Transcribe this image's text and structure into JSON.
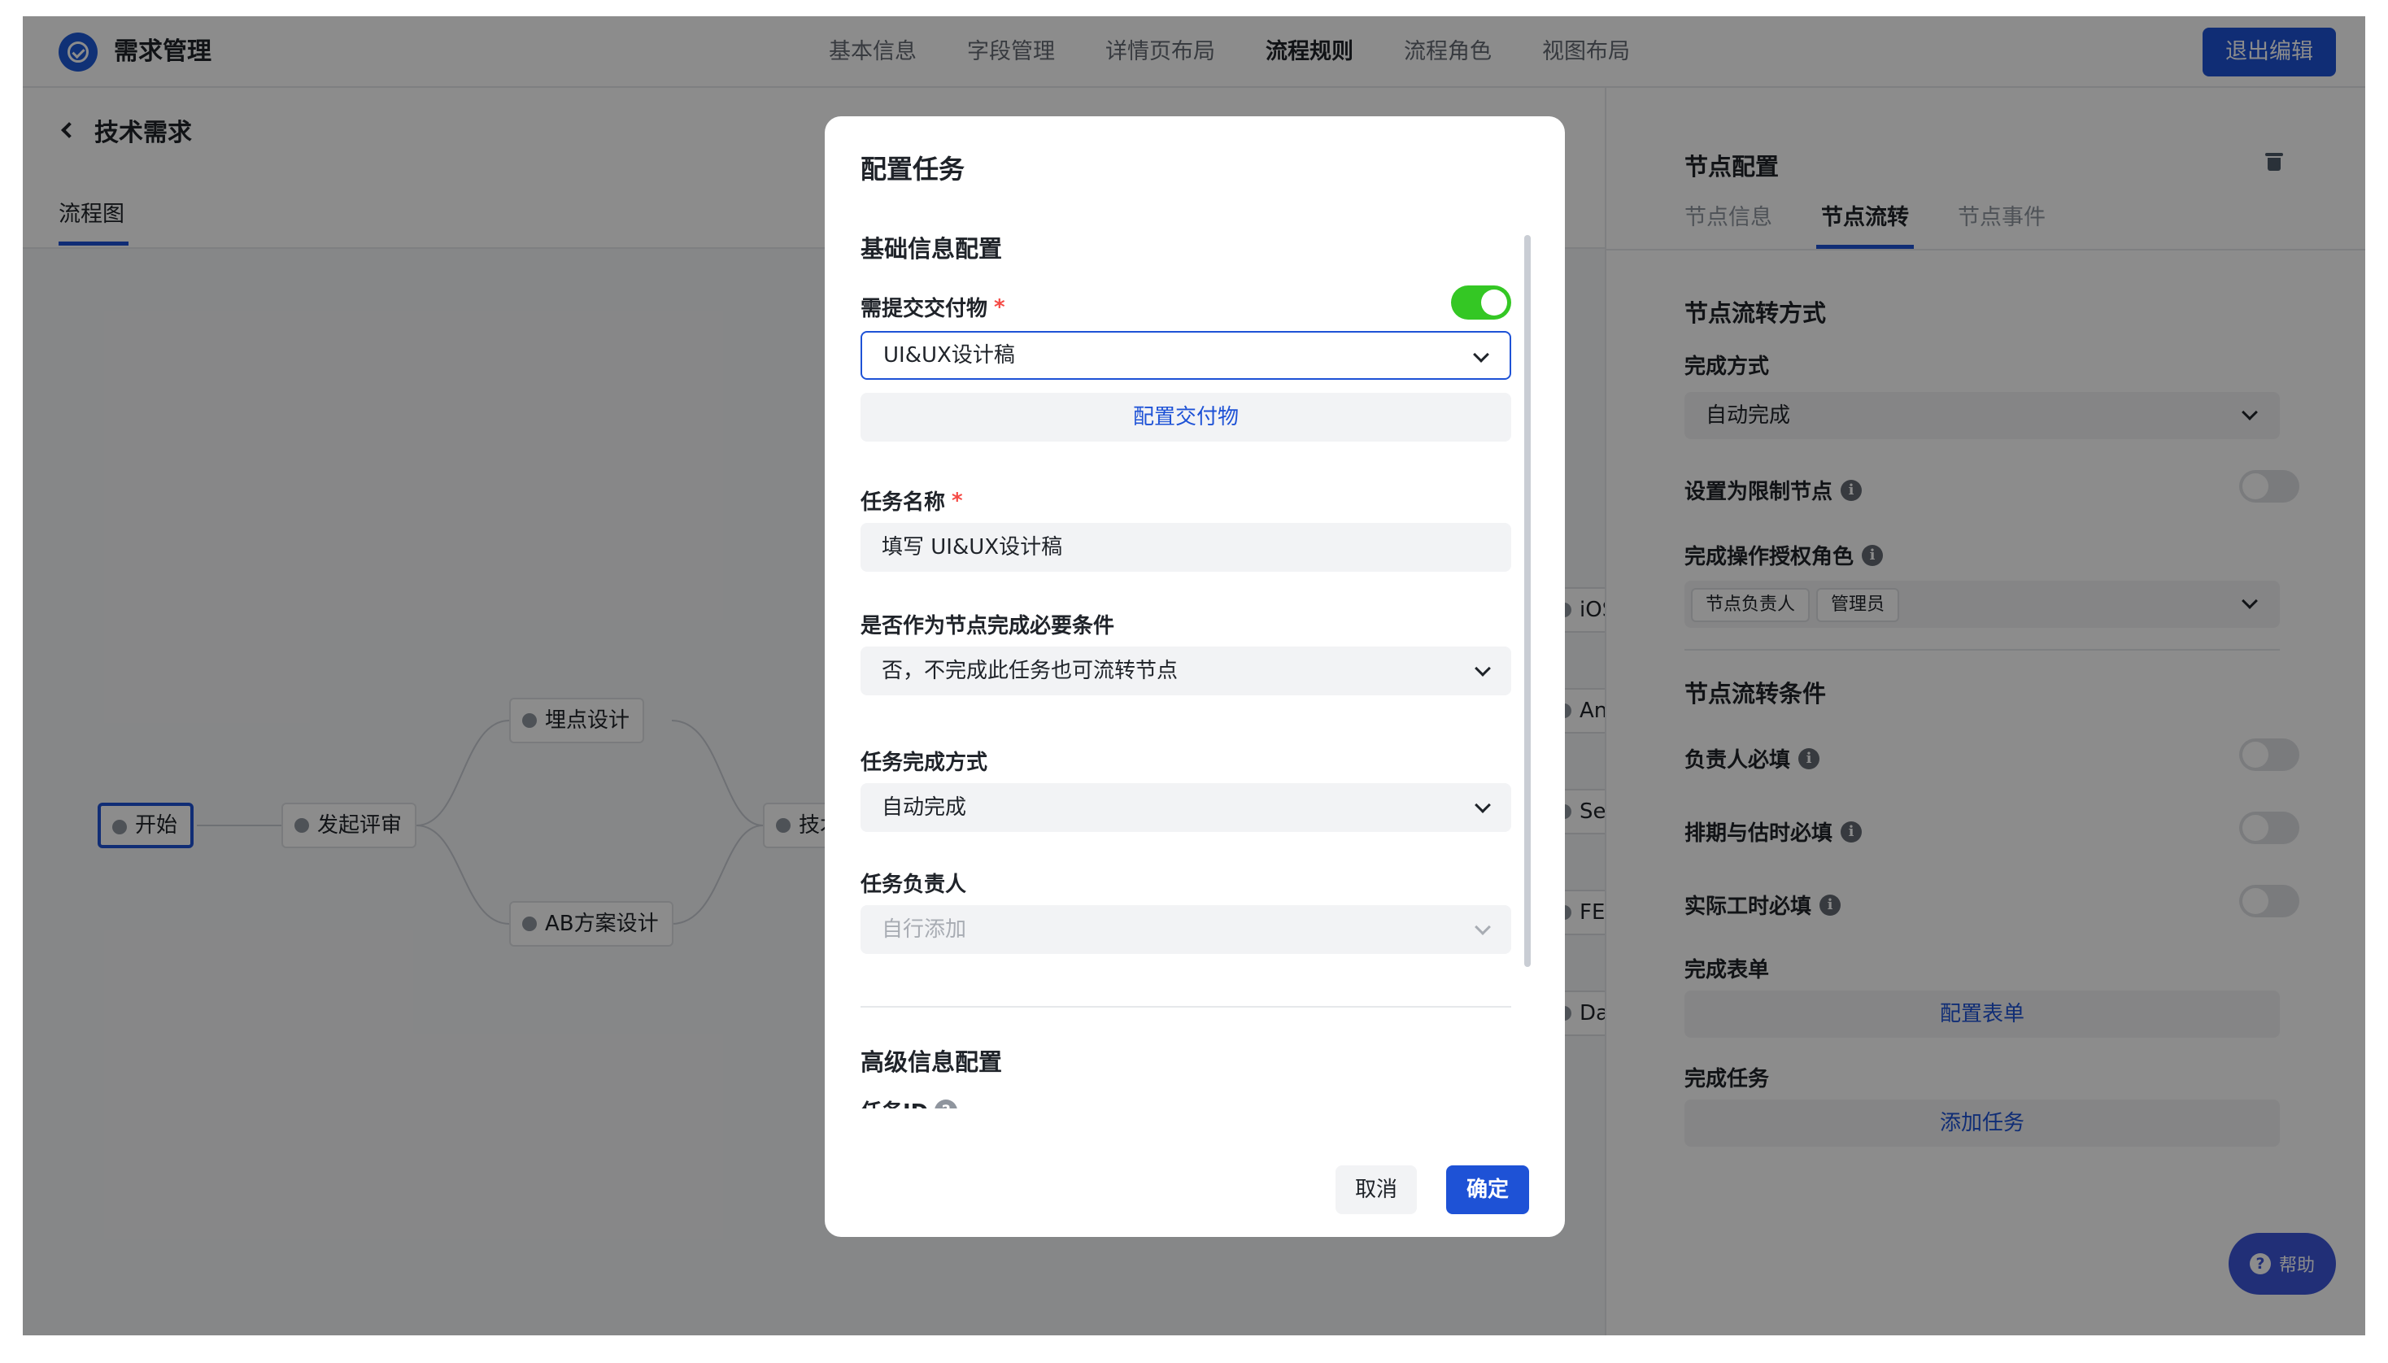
{
  "app": {
    "title": "需求管理"
  },
  "nav": [
    {
      "label": "基本信息"
    },
    {
      "label": "字段管理"
    },
    {
      "label": "详情页布局"
    },
    {
      "label": "流程规则"
    },
    {
      "label": "流程角色"
    },
    {
      "label": "视图布局"
    }
  ],
  "active_nav": "流程规则",
  "toolbar": {
    "exit_label": "退出编辑"
  },
  "left": {
    "page_title": "技术需求",
    "tab_label": "流程图",
    "nodes": [
      {
        "label": "开始"
      },
      {
        "label": "发起评审"
      },
      {
        "label": "埋点设计"
      },
      {
        "label": "AB方案设计"
      },
      {
        "label": "技术"
      },
      {
        "label": "iOS"
      },
      {
        "label": "An"
      },
      {
        "label": "Se"
      },
      {
        "label": "FE"
      },
      {
        "label": "Da"
      }
    ]
  },
  "right_panel": {
    "title": "节点配置",
    "tabs": [
      {
        "label": "节点信息"
      },
      {
        "label": "节点流转"
      },
      {
        "label": "节点事件"
      }
    ],
    "section1_title": "节点流转方式",
    "complete_mode_label": "完成方式",
    "complete_mode_value": "自动完成",
    "limit_node_label": "设置为限制节点",
    "auth_role_label": "完成操作授权角色",
    "auth_roles": [
      "节点负责人",
      "管理员"
    ],
    "section2_title": "节点流转条件",
    "owner_required_label": "负责人必填",
    "schedule_required_label": "排期与估时必填",
    "worktime_required_label": "实际工时必填",
    "form_label": "完成表单",
    "form_button": "配置表单",
    "task_label": "完成任务",
    "task_button": "添加任务",
    "help_label": "帮助"
  },
  "modal": {
    "title": "配置任务",
    "basic_section": "基础信息配置",
    "deliverable_label": "需提交交付物",
    "deliverable_toggle": true,
    "deliverable_value": "UI&UX设计稿",
    "config_deliverable_button": "配置交付物",
    "task_name_label": "任务名称",
    "task_name_value": "填写 UI&UX设计稿",
    "required_cond_label": "是否作为节点完成必要条件",
    "required_cond_value": "否，不完成此任务也可流转节点",
    "task_complete_label": "任务完成方式",
    "task_complete_value": "自动完成",
    "task_owner_label": "任务负责人",
    "task_owner_placeholder": "自行添加",
    "advanced_section": "高级信息配置",
    "task_id_label": "任务ID",
    "cancel_label": "取消",
    "ok_label": "确定"
  },
  "colors": {
    "primary": "#1e52d6",
    "toggle_on": "#34c724",
    "required": "#f54a45"
  },
  "icons": [
    "check-circle-icon",
    "back-arrow-icon",
    "trash-icon",
    "info-icon",
    "chevron-down-icon",
    "question-icon"
  ]
}
